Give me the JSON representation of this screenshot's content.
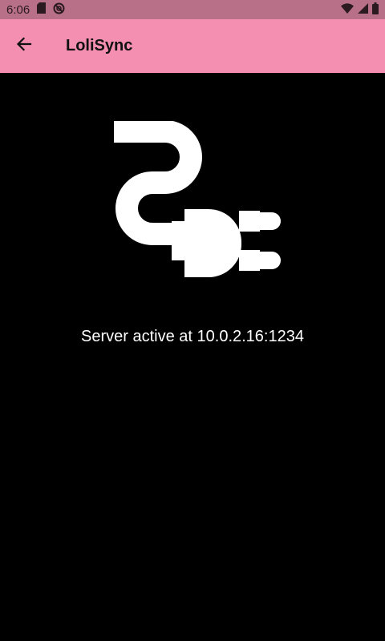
{
  "status_bar": {
    "time": "6:06",
    "icons": [
      "sd-card-icon",
      "sync-disabled-icon",
      "wifi-icon",
      "signal-icon",
      "battery-icon"
    ]
  },
  "app_bar": {
    "title": "LoliSync",
    "back_icon": "arrow-back-icon",
    "background_color": "#f48fb1"
  },
  "main": {
    "icon": "power-plug-icon",
    "status_text": "Server active at 10.0.2.16:1234"
  }
}
